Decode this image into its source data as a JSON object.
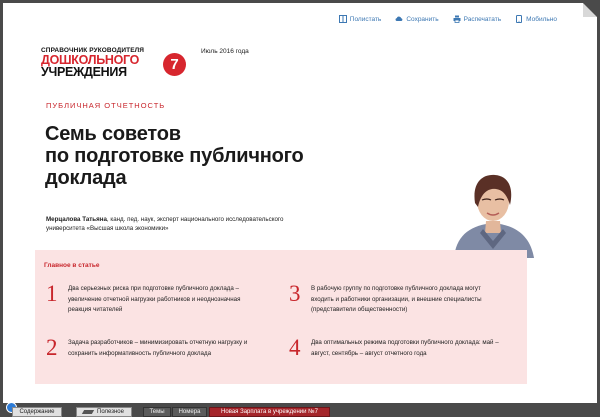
{
  "toolbar": {
    "items": [
      {
        "label": "Полистать",
        "icon": "browse-icon"
      },
      {
        "label": "Сохранить",
        "icon": "save-cloud-icon"
      },
      {
        "label": "Распечатать",
        "icon": "print-icon"
      },
      {
        "label": "Мобильно",
        "icon": "mobile-icon"
      }
    ]
  },
  "logo": {
    "line1": "СПРАВОЧНИК РУКОВОДИТЕЛЯ",
    "line2": "ДОШКОЛЬНОГО",
    "line3": "УЧРЕЖДЕНИЯ",
    "issue_number": "7"
  },
  "issue_date": "Июль 2016 года",
  "section_label": "ПУБЛИЧНАЯ ОТЧЕТНОСТЬ",
  "title": {
    "line1": "Семь советов",
    "line2": "по подготовке публичного",
    "line3": "доклада"
  },
  "author": {
    "name": "Мерцалова Татьяна",
    "desc_line1": ", канд. пед. наук, эксперт национального исследовательского",
    "desc_line2": "университета «Высшая школа экономики»"
  },
  "summary": {
    "title": "Главное в статье",
    "items": [
      {
        "num": "1",
        "text": "Два серьезных риска при подготовке публичного доклада – увеличение отчетной нагрузки работников и неоднозначная реакция читателей"
      },
      {
        "num": "2",
        "text": "Задача разработчиков – минимизировать отчетную нагрузку и сохранить информативность публичного доклада"
      },
      {
        "num": "3",
        "text": "В рабочую группу по подготовке публичного доклада могут входить и работники организации, и внешние специалисты (представители общественности)"
      },
      {
        "num": "4",
        "text": "Два оптимальных режима подготовки публичного доклада: май – август, сентябрь – август отчетного года"
      }
    ]
  },
  "bottombar": {
    "contents": "Содержание",
    "useful": "Полезное",
    "topics": "Темы",
    "issues": "Номера",
    "promo": "Новая Зарплата в учреждении №7"
  },
  "colors": {
    "accent_red": "#c8262c",
    "link_blue": "#3d78b3",
    "summary_bg": "#fbe3e3"
  }
}
